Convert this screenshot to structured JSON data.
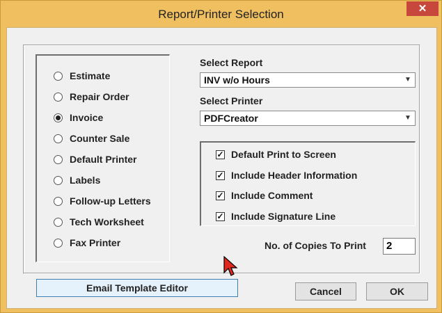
{
  "window": {
    "title": "Report/Printer Selection",
    "close_glyph": "✕"
  },
  "report_types": [
    {
      "label": "Estimate",
      "checked": false
    },
    {
      "label": "Repair Order",
      "checked": false
    },
    {
      "label": "Invoice",
      "checked": true
    },
    {
      "label": "Counter Sale",
      "checked": false
    },
    {
      "label": "Default Printer",
      "checked": false
    },
    {
      "label": "Labels",
      "checked": false
    },
    {
      "label": "Follow-up Letters",
      "checked": false
    },
    {
      "label": "Tech Worksheet",
      "checked": false
    },
    {
      "label": "Fax Printer",
      "checked": false
    }
  ],
  "select_report": {
    "label": "Select Report",
    "value": "INV w/o Hours"
  },
  "select_printer": {
    "label": "Select Printer",
    "value": "PDFCreator"
  },
  "options": [
    {
      "label": "Default Print to Screen",
      "checked": true
    },
    {
      "label": "Include Header Information",
      "checked": true
    },
    {
      "label": "Include Comment",
      "checked": true
    },
    {
      "label": "Include Signature Line",
      "checked": true
    }
  ],
  "copies": {
    "label": "No. of Copies To Print",
    "value": "2"
  },
  "buttons": {
    "email_template": "Email Template Editor",
    "cancel": "Cancel",
    "ok": "OK"
  },
  "colors": {
    "title_bar": "#f0c060",
    "close_button": "#c7473c",
    "dialog_bg": "#f0f0f0"
  }
}
